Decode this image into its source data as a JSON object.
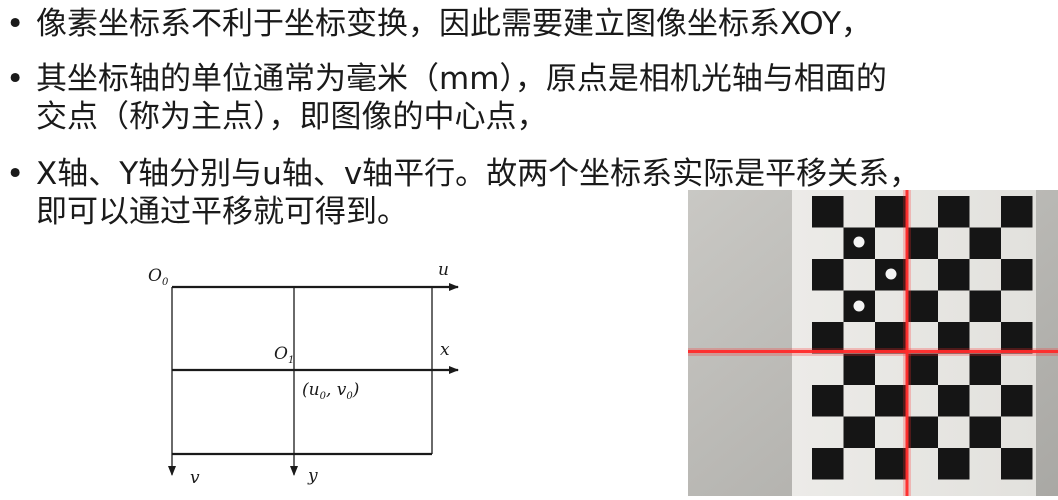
{
  "bullets": [
    {
      "marker": "•",
      "lines": [
        "像素坐标系不利于坐标变换，因此需要建立图像坐标系XOY，"
      ]
    },
    {
      "marker": "•",
      "lines": [
        "其坐标轴的单位通常为毫米（mm），原点是相机光轴与相面的",
        "交点（称为主点），即图像的中心点，"
      ]
    },
    {
      "marker": "•",
      "lines": [
        "X轴、Y轴分别与u轴、v轴平行。故两个坐标系实际是平移关系，",
        "即可以通过平移就可得到。"
      ]
    }
  ],
  "diagram": {
    "origin0": "O",
    "origin0_sub": "0",
    "origin1": "O",
    "origin1_sub": "1",
    "u_axis": "u",
    "x_axis": "x",
    "v_axis": "v",
    "y_axis": "y",
    "principal_point": "(u",
    "principal_point_sub0": "0",
    "principal_point_mid": ", v",
    "principal_point_sub1": "0",
    "principal_point_end": ")"
  },
  "photo": {
    "subject": "checkerboard calibration pattern with red laser crosshair",
    "colors": {
      "laser": "#ff2a2a",
      "square": "#151515",
      "paper": "#f2f2f0",
      "wall": "#bdbcb8"
    }
  }
}
